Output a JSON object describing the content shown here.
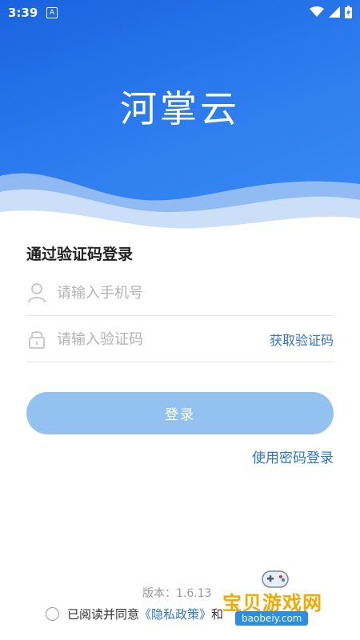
{
  "status_bar": {
    "time": "3:39",
    "a_badge": "A"
  },
  "header": {
    "app_title": "河掌云"
  },
  "login": {
    "heading": "通过验证码登录",
    "phone_placeholder": "请输入手机号",
    "code_placeholder": "请输入验证码",
    "get_code_label": "获取验证码",
    "login_button": "登录",
    "password_login_link": "使用密码登录"
  },
  "footer": {
    "version": "版本：1.6.13",
    "agree_prefix": "已阅读并同意",
    "privacy_policy": "《隐私政策》",
    "and_text": "和"
  },
  "watermark": {
    "text": "宝贝游戏网",
    "url": "baobeiy.com"
  },
  "colors": {
    "primary": "#2f74d8",
    "header": "#1a63df",
    "button_disabled": "#93c2f1"
  }
}
